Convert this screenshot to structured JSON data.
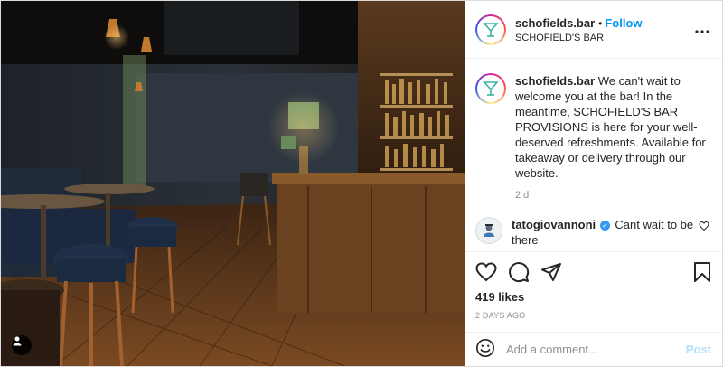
{
  "header": {
    "username": "schofields.bar",
    "separator": "•",
    "follow_label": "Follow",
    "location": "SCHOFIELD'S BAR",
    "more_icon": "more-dots-icon"
  },
  "caption": {
    "username": "schofields.bar",
    "text": " We can't wait to welcome you at the bar! In the meantime, SCHOFIELD'S BAR PROVISIONS is here for your well-deserved refreshments. Available for takeaway or delivery through our website.",
    "time": "2 d"
  },
  "comments": [
    {
      "username": "tatogiovannoni",
      "verified": true,
      "text": " Cant wait to be there"
    }
  ],
  "actions": {
    "icons": [
      "heart-icon",
      "comment-icon",
      "share-icon",
      "bookmark-icon"
    ]
  },
  "likes": "419 likes",
  "date": "2 DAYS AGO",
  "add_comment": {
    "placeholder": "Add a comment...",
    "post_label": "Post"
  },
  "colors": {
    "accent": "#0095f6",
    "post_disabled": "#b2dffc",
    "verified": "#3897f0"
  }
}
